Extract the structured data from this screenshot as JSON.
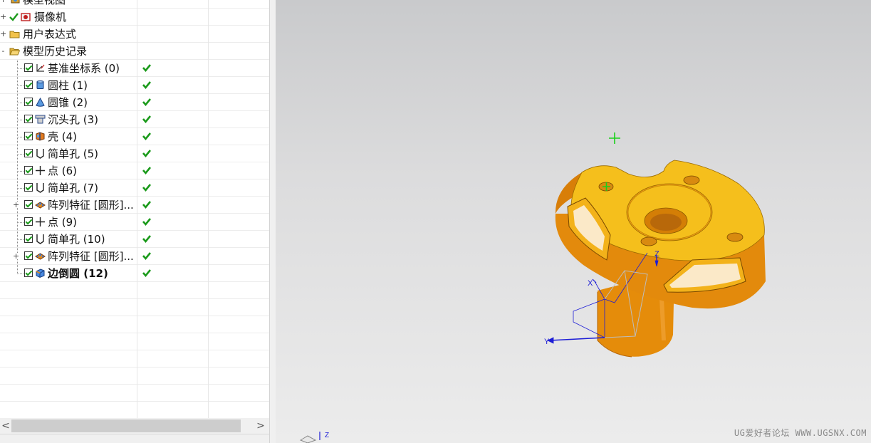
{
  "navigator": {
    "items": [
      {
        "label": "模型视图",
        "expander": "+"
      },
      {
        "label": "摄像机",
        "expander": "+"
      },
      {
        "label": "用户表达式",
        "expander": "+"
      },
      {
        "label": "模型历史记录",
        "expander": "-"
      },
      {
        "label": "基准坐标系 (0)",
        "status": "check"
      },
      {
        "label": "圆柱 (1)",
        "status": "check"
      },
      {
        "label": "圆锥 (2)",
        "status": "check"
      },
      {
        "label": "沉头孔 (3)",
        "status": "check"
      },
      {
        "label": "壳 (4)",
        "status": "check"
      },
      {
        "label": "简单孔 (5)",
        "status": "check"
      },
      {
        "label": "点 (6)",
        "status": "check"
      },
      {
        "label": "简单孔 (7)",
        "status": "check"
      },
      {
        "label": "阵列特征 [圆形]...",
        "expander": "+",
        "status": "check"
      },
      {
        "label": "点 (9)",
        "status": "check"
      },
      {
        "label": "简单孔 (10)",
        "status": "check"
      },
      {
        "label": "阵列特征 [圆形]...",
        "expander": "+",
        "status": "check"
      },
      {
        "label": "边倒圆 (12)",
        "status": "check",
        "bold": true
      }
    ]
  },
  "scrollbar": {
    "left_arrow": "<",
    "right_arrow": ">"
  },
  "viewport": {
    "triad_labels": {
      "x": "X",
      "y": "Y",
      "z": "Z"
    },
    "mini_triad_z": "Z",
    "watermark": "UG爱好者论坛 WWW.UGSNX.COM"
  },
  "colors": {
    "part_face": "#f5bf1c",
    "part_side": "#e08a0a",
    "csys": "#1c1cd6",
    "check_green": "#1a9a1a"
  }
}
